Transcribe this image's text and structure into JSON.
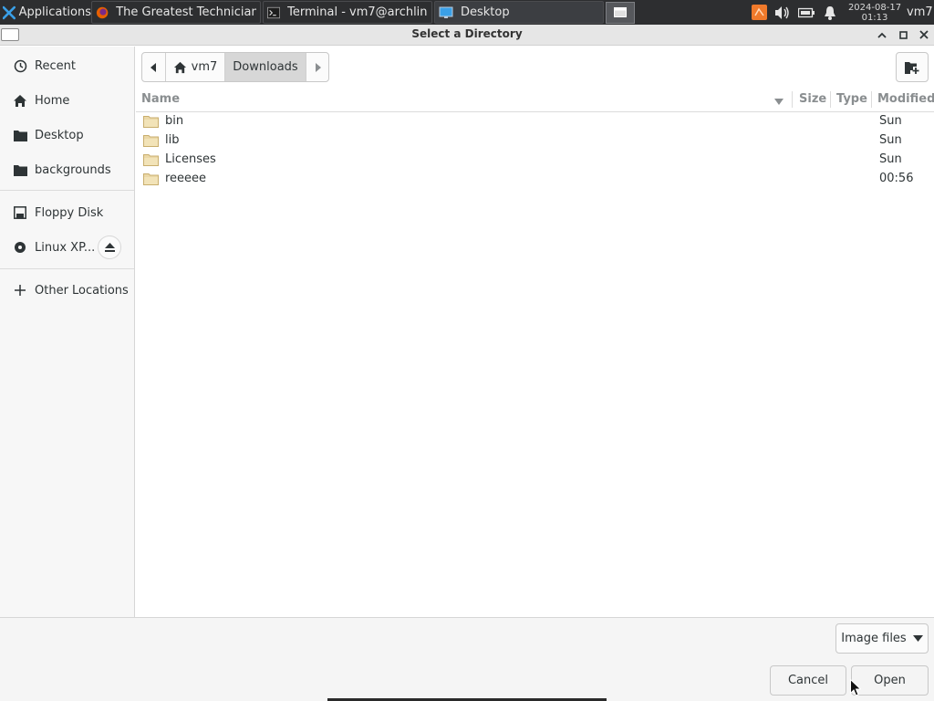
{
  "taskbar": {
    "app_menu_label": "Applications",
    "tasks": [
      {
        "label": "The Greatest Technician ..."
      },
      {
        "label": "Terminal - vm7@archlinu..."
      },
      {
        "label": "Desktop"
      }
    ],
    "clock": {
      "date": "2024-08-17",
      "time": "01:13"
    },
    "user": "vm7"
  },
  "dialog": {
    "title": "Select a Directory"
  },
  "sidebar": {
    "places": [
      {
        "label": "Recent",
        "icon": "clock-icon"
      },
      {
        "label": "Home",
        "icon": "home-icon"
      },
      {
        "label": "Desktop",
        "icon": "folder-icon"
      },
      {
        "label": "backgrounds",
        "icon": "folder-icon"
      }
    ],
    "devices": [
      {
        "label": "Floppy Disk",
        "icon": "floppy-icon"
      },
      {
        "label": "Linux XP...",
        "icon": "disc-icon"
      }
    ],
    "other_locations": "Other Locations"
  },
  "pathbar": {
    "home_label": "vm7",
    "current_label": "Downloads"
  },
  "columns": {
    "name": "Name",
    "size": "Size",
    "type": "Type",
    "modified": "Modified"
  },
  "files": [
    {
      "name": "bin",
      "modified": "Sun"
    },
    {
      "name": "lib",
      "modified": "Sun"
    },
    {
      "name": "Licenses",
      "modified": "Sun"
    },
    {
      "name": "reeeee",
      "modified": "00:56"
    }
  ],
  "filter": {
    "label": "Image files"
  },
  "buttons": {
    "cancel": "Cancel",
    "open": "Open"
  },
  "colors": {
    "taskbar_bg": "#2d2e30",
    "folder_fill": "#e8d5a3",
    "selected_path_segment": "#d7d7d7"
  }
}
